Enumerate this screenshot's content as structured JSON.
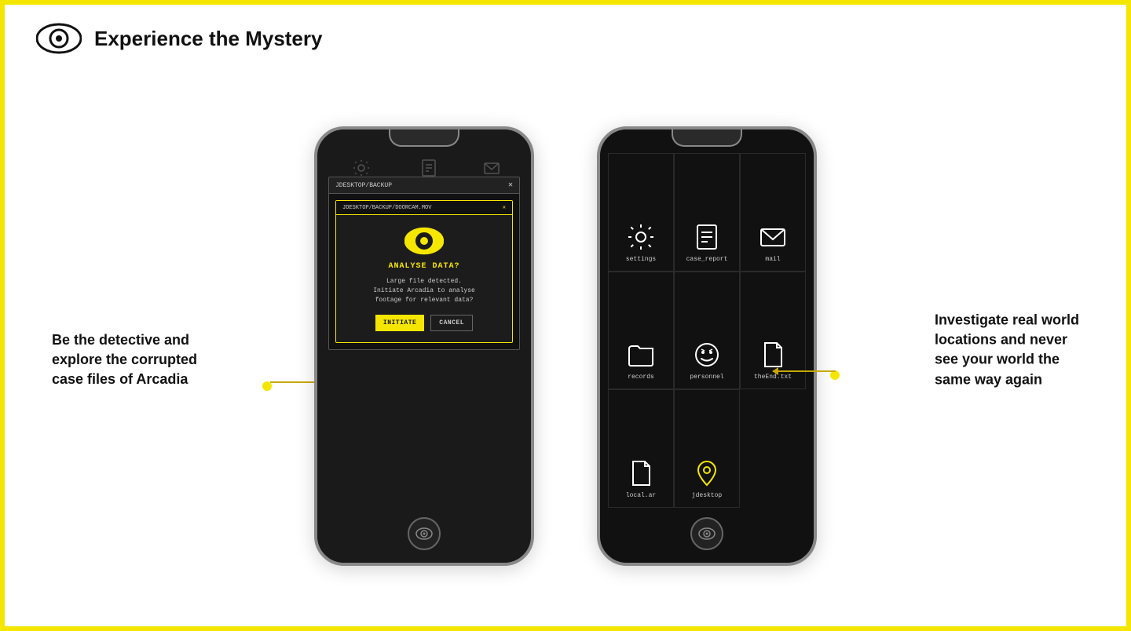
{
  "header": {
    "title": "Experience the Mystery"
  },
  "annotation_left": {
    "line1": "Be the detective and",
    "line2": "explore the corrupted",
    "line3": "case files of Arcadia"
  },
  "annotation_right": {
    "line1": "Investigate real world",
    "line2": "locations and never",
    "line3": "see your world the",
    "line4": "same way again"
  },
  "phone1": {
    "top_icons": [
      {
        "label": "settings"
      },
      {
        "label": "case_report"
      },
      {
        "label": "mail"
      }
    ],
    "modal": {
      "titlebar": "JDESKTOP/BACKUP",
      "inner_titlebar": "JDESKTOP/BACKUP/DOORCAM.MOV",
      "analyse_title": "ANALYSE DATA?",
      "analyse_desc": "Large file detected.\nInitiate Arcadia to analyse\nfootage for relevant data?",
      "btn_initiate": "INITIATE",
      "btn_cancel": "CANCEL"
    }
  },
  "phone2": {
    "icons": [
      {
        "label": "settings",
        "type": "gear"
      },
      {
        "label": "case_report",
        "type": "document"
      },
      {
        "label": "mail",
        "type": "mail"
      },
      {
        "label": "records",
        "type": "folder"
      },
      {
        "label": "personnel",
        "type": "smiley"
      },
      {
        "label": "theEnd.txt",
        "type": "file"
      },
      {
        "label": "local.ar",
        "type": "file-blank"
      },
      {
        "label": "jdesktop",
        "type": "location"
      }
    ]
  }
}
